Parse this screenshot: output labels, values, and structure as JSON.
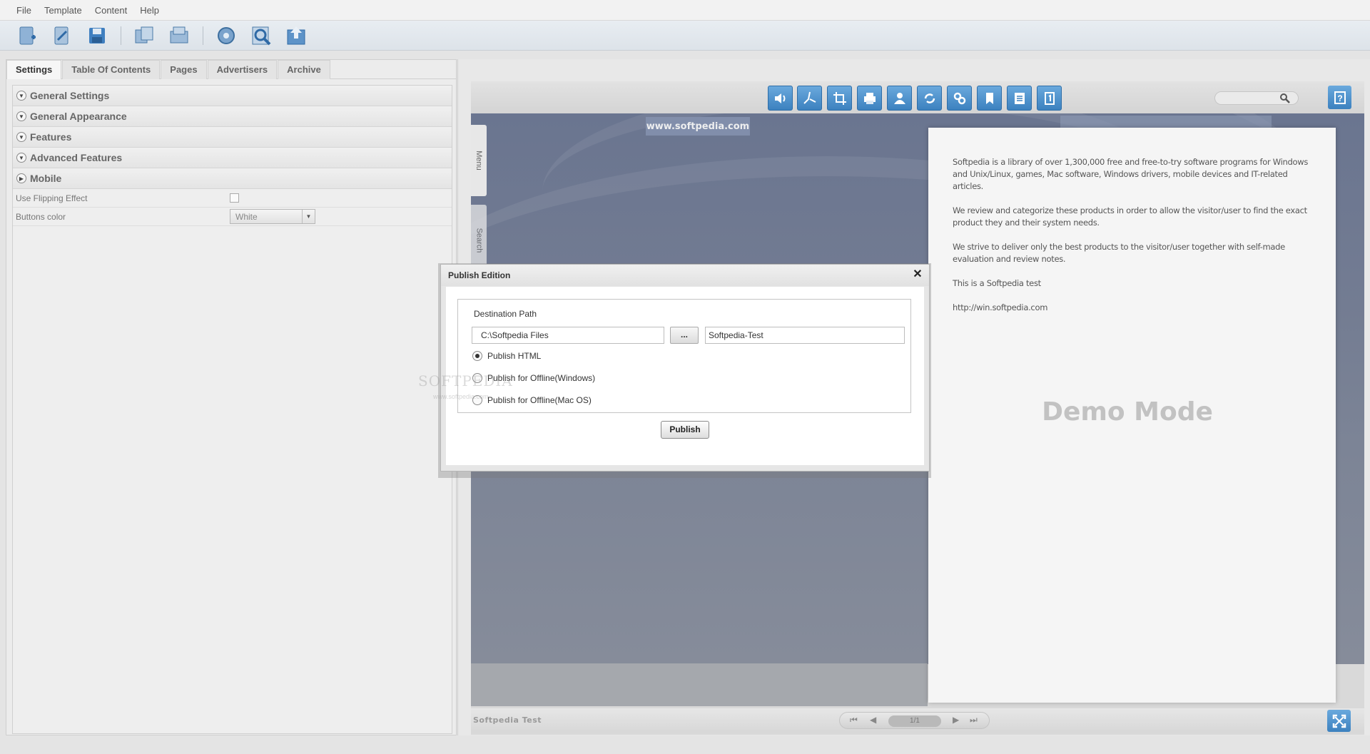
{
  "menubar": {
    "items": [
      "File",
      "Template",
      "Content",
      "Help"
    ]
  },
  "toolbar": {
    "icons": [
      "new-project-icon",
      "open-project-icon",
      "save-icon",
      "import-pdf-icon",
      "batch-convert-icon",
      "settings-wheel-icon",
      "preview-icon",
      "publish-icon"
    ]
  },
  "left_panel": {
    "tabs": [
      "Settings",
      "Table Of Contents",
      "Pages",
      "Advertisers",
      "Archive"
    ],
    "active_tab": "Settings",
    "sections": [
      "General Settings",
      "General Appearance",
      "Features",
      "Advanced Features",
      "Mobile"
    ],
    "props": {
      "flipping_label": "Use Flipping Effect",
      "buttons_color_label": "Buttons color",
      "buttons_color_value": "White"
    }
  },
  "preview": {
    "banner": "www.softpedia.com",
    "side_tabs": [
      "Menu",
      "Search"
    ],
    "page_paragraphs": [
      "Softpedia is a library of over 1,300,000 free and free-to-try software programs for Windows and Unix/Linux, games, Mac software, Windows drivers, mobile devices and IT-related articles.",
      "We review and categorize these products in order to allow the visitor/user to find the exact product they and their system needs.",
      "We strive to deliver only the best products to the visitor/user together with self-made evaluation and review notes.",
      "This is a Softpedia test",
      "http://win.softpedia.com"
    ],
    "demo_mode": "Demo Mode",
    "footer_label": "Softpedia Test",
    "page_indicator": "1/1",
    "toolbar_icons": [
      "sound-icon",
      "pdf-icon",
      "crop-icon",
      "print-icon",
      "user-icon",
      "share-icon",
      "link-icon",
      "bookmark-icon",
      "notes-icon",
      "single-page-icon"
    ]
  },
  "dialog": {
    "title": "Publish Edition",
    "legend": "Destination Path",
    "path_value": "C:\\Softpedia Files",
    "browse_label": "...",
    "name_value": "Softpedia-Test",
    "options": [
      "Publish HTML",
      "Publish for Offline(Windows)",
      "Publish for Offline(Mac OS)"
    ],
    "selected_option": "Publish HTML",
    "publish_label": "Publish"
  },
  "watermark": {
    "main": "SOFTPEDIA",
    "sub": "www.softpedia.com"
  }
}
